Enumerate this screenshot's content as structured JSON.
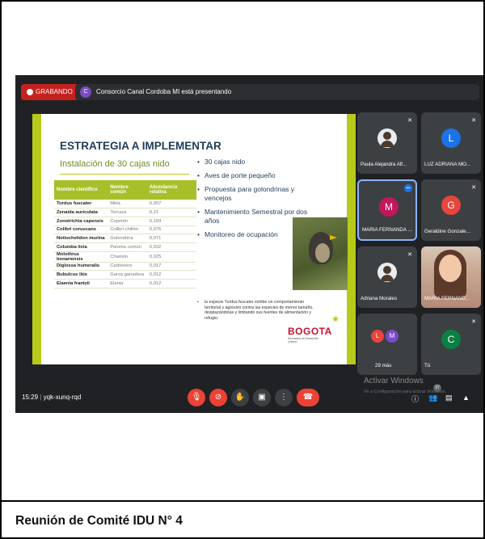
{
  "caption": "Reunión de Comité IDU N° 4",
  "topbar": {
    "recording_label": "GRABANDO",
    "presenter_initial": "C",
    "presenting_text": "Consorcio Canal Cordoba MI está presentando"
  },
  "slide": {
    "title": "ESTRATEGIA A IMPLEMENTAR",
    "subtitle": "Instalación de 30 cajas nido",
    "table_headers": [
      "Nombre científico",
      "Nombre común",
      "Abundancia relativa"
    ],
    "table_rows": [
      [
        "Turdus fuscater",
        "Mirla",
        "0,307"
      ],
      [
        "Zenaida auriculata",
        "Torcaza",
        "0,21"
      ],
      [
        "Zonotrichia capensis",
        "Copetón",
        "0,109"
      ],
      [
        "Colibri coruscans",
        "Colibrí chillón",
        "0,076"
      ],
      [
        "Notiochelidon murina",
        "Golondrina",
        "0,071"
      ],
      [
        "Columba livia",
        "Paloma común",
        "0,032"
      ],
      [
        "Molothrus bonariensis",
        "Chamón",
        "0,025"
      ],
      [
        "Diglossa humeralis",
        "Carbonero",
        "0,017"
      ],
      [
        "Bubulcus ibis",
        "Garza ganadera",
        "0,012"
      ],
      [
        "Elaenia frantzii",
        "Elania",
        "0,012"
      ]
    ],
    "bullets": [
      "30 cajas nido",
      "Aves de porte pequeño",
      "Propuesta para golondrinas y vencejos",
      "Mantenimiento Semestral por dos años",
      "Monitoreo de ocupación"
    ],
    "note": "la especie Turdus fuscater exhibe un comportamiento territorial y agresivo contra las especies de menor tamaño, desplazándolas y limitando sus fuentes de alimentación y refugio.",
    "logo_text": "BOGOTA",
    "logo_sub": "Secretaría de Desarrollo Urbano"
  },
  "participants": [
    {
      "name": "Paula Alejandra Alf...",
      "kind": "photo"
    },
    {
      "name": "LUZ ADRIANA MO...",
      "kind": "avatar",
      "initial": "L",
      "color": "#1a73e8"
    },
    {
      "name": "MARIA FERNANDA ...",
      "kind": "avatar",
      "initial": "M",
      "color": "#c2185b"
    },
    {
      "name": "Geraldine Gonzale...",
      "kind": "avatar",
      "initial": "G",
      "color": "#e8453c"
    },
    {
      "name": "Adriana Morales",
      "kind": "photo"
    },
    {
      "name": "MARIA FERNAND...",
      "kind": "camera"
    },
    {
      "name": "29 más",
      "kind": "group"
    },
    {
      "name": "Tú",
      "kind": "avatar",
      "initial": "C",
      "color": "#0b8043"
    }
  ],
  "bottombar": {
    "time": "15:29",
    "meeting_code": "yqk-xunq-rqd",
    "badge_count": "37"
  },
  "windows": {
    "line1": "Activar Windows",
    "line2": "Ve a Configuración para activar Windows."
  },
  "colors": {
    "accent": "#b7c91a",
    "record": "#c5221f",
    "end_call": "#ea4335"
  }
}
